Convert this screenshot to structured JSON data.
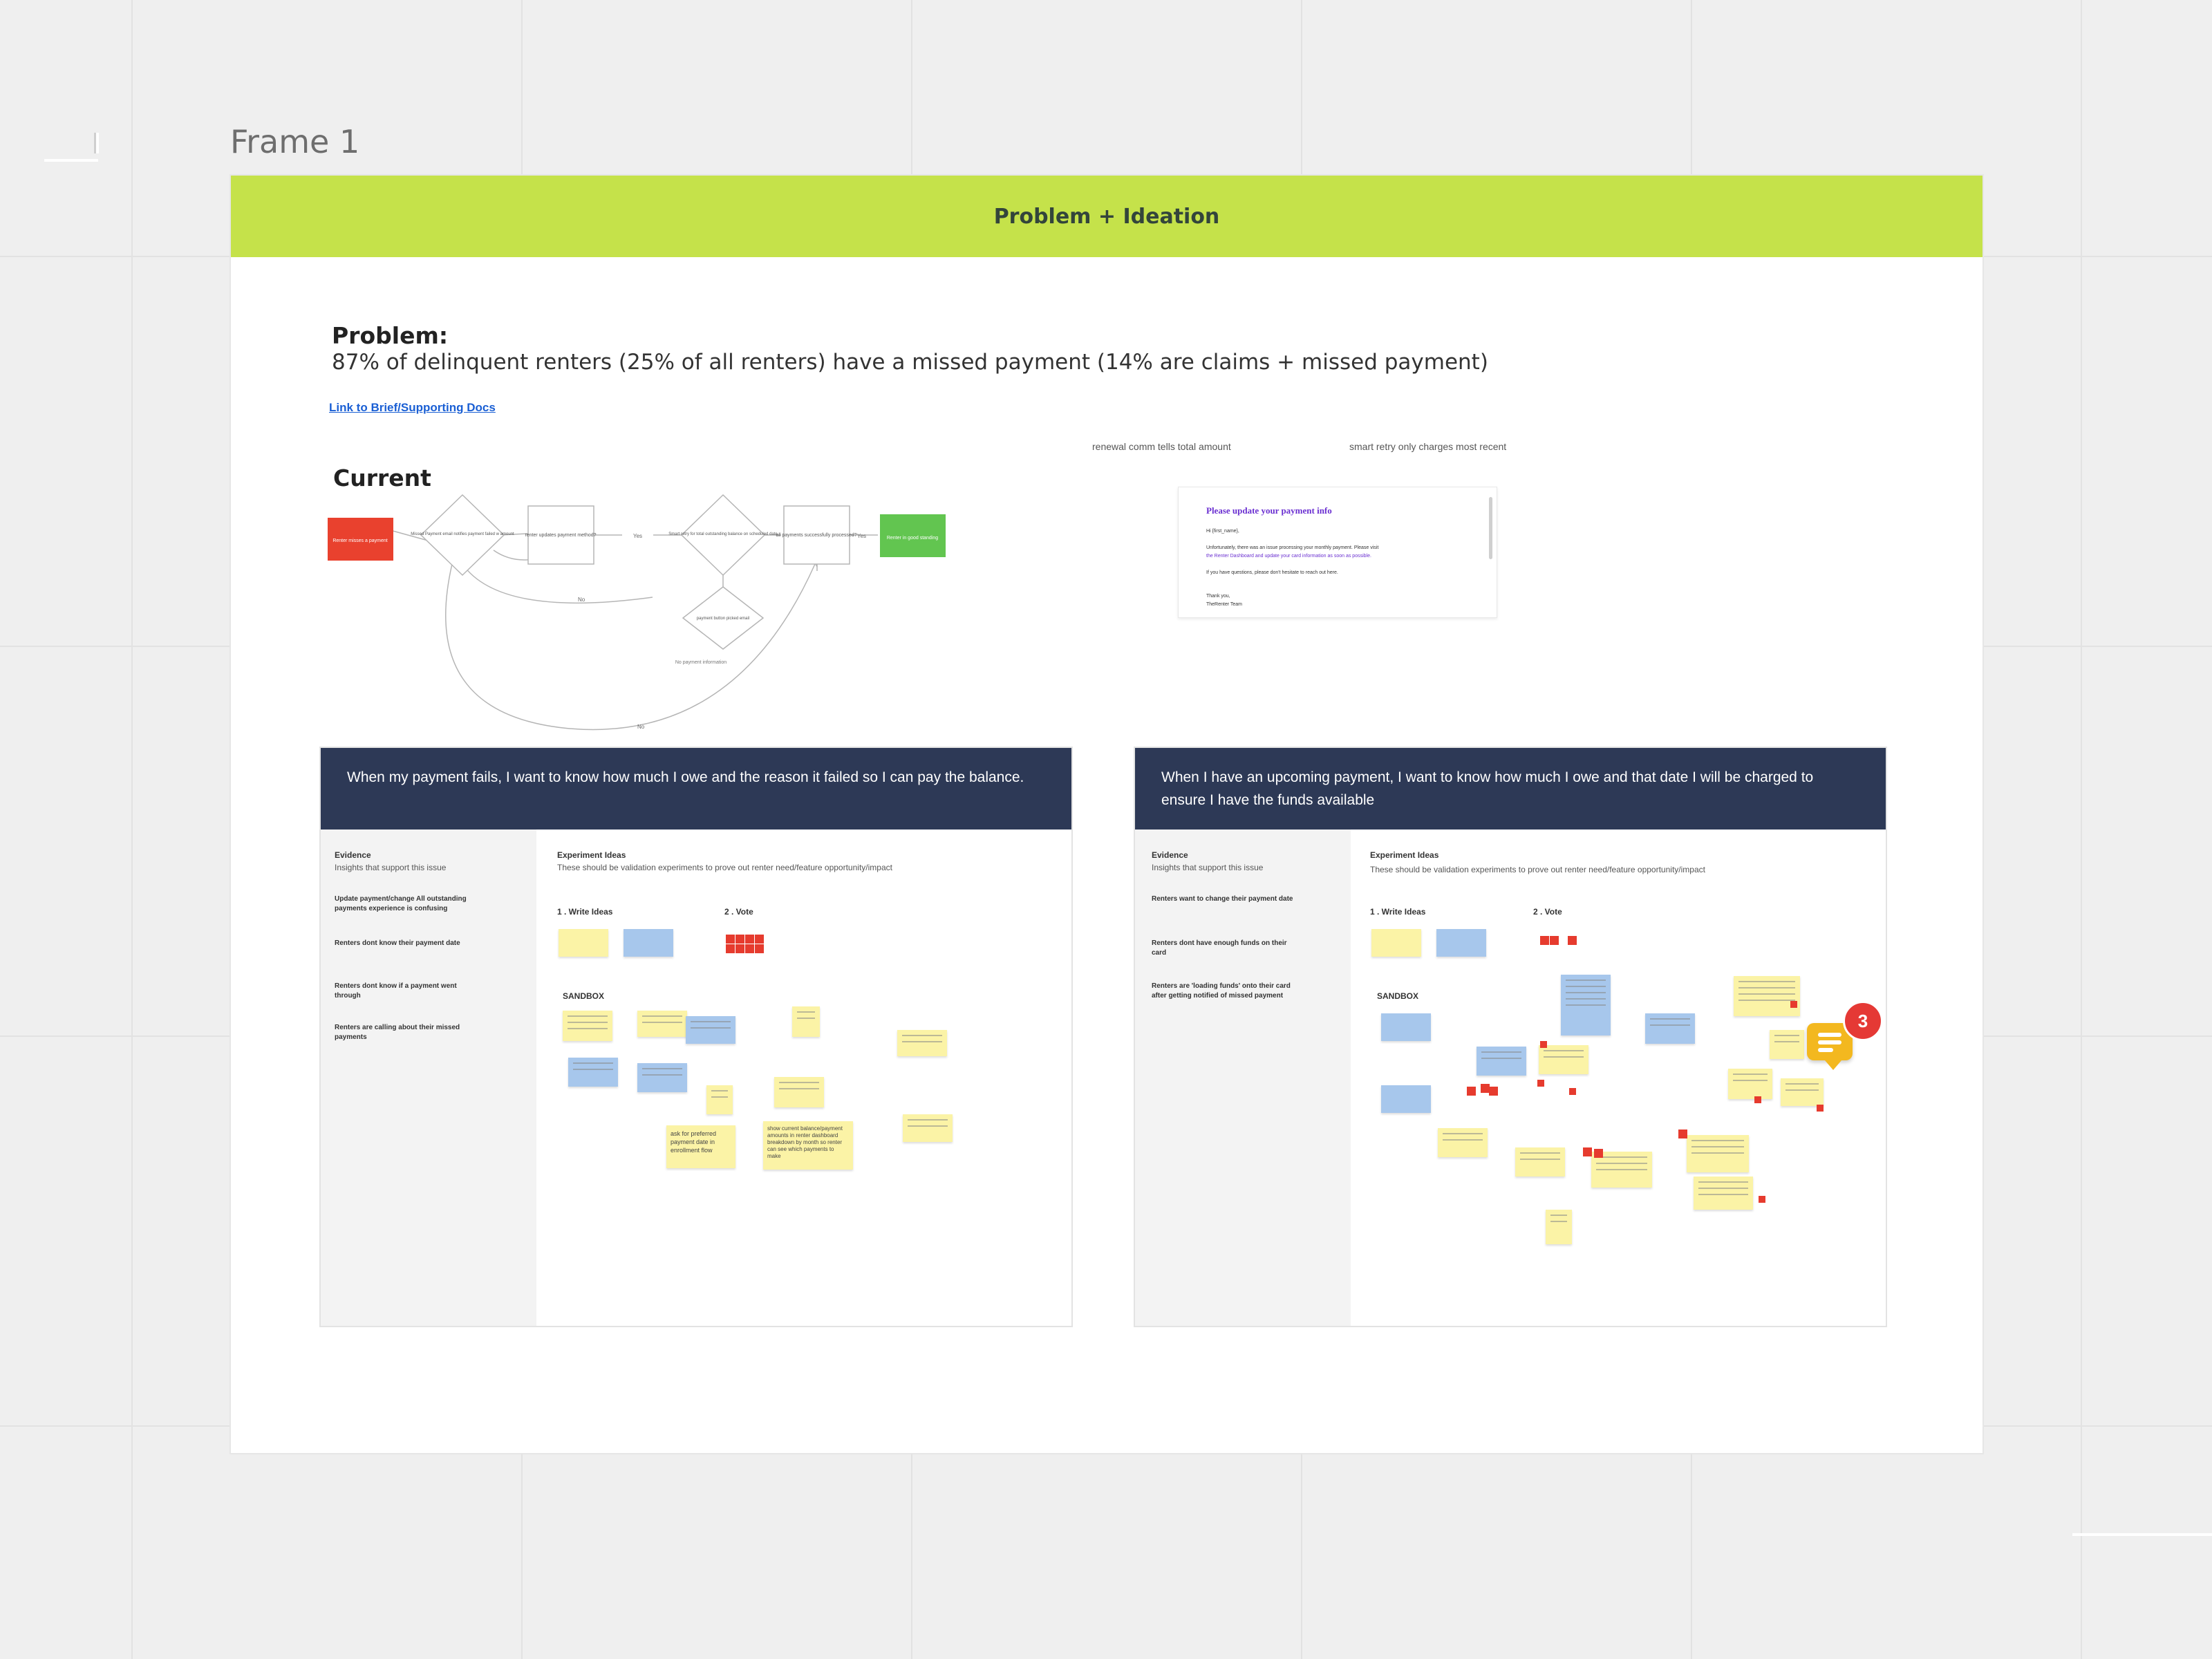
{
  "frame": {
    "label": "Frame 1"
  },
  "banner": {
    "title": "Problem + Ideation"
  },
  "problem": {
    "heading": "Problem:",
    "text": "87% of delinquent renters (25% of all renters) have a missed payment (14% are claims + missed payment)",
    "link": "Link to Brief/Supporting Docs"
  },
  "current": {
    "heading": "Current",
    "flow": {
      "start": "Renter misses a payment",
      "d1": "Missed Payment email notifies payment failed w amount",
      "p1": "renter updates payment method?",
      "yes1": "Yes",
      "d2": "Smart retry for total outstanding balance on scheduled date",
      "p2": "all payments successfully processed?",
      "yes2": "Yes",
      "end": "Renter in good standing",
      "d3": "payment button picked email",
      "no1": "No",
      "no2": "No",
      "loop": "No payment information"
    },
    "notes": [
      "renewal comm tells total amount",
      "smart retry only charges most recent"
    ],
    "email": {
      "subject": "Please update your payment info",
      "lines": [
        "Hi {first_name},",
        "Unfortunately, there was an issue processing your monthly payment. Please visit",
        "the Renter Dashboard and update your card information as soon as possible.",
        "If you have questions, please don't hesitate to reach out here.",
        "Thank you,",
        "TheRenter Team"
      ]
    }
  },
  "card_left": {
    "header": "When my payment fails, I want to know how much I owe and the reason it failed so I can pay the balance.",
    "evidence_title": "Evidence",
    "evidence_sub": "Insights that support this issue",
    "evidence": [
      "Update payment/change All outstanding payments experience is confusing",
      "Renters dont know their payment date",
      "Renters dont know if a payment went through",
      "Renters are calling about their missed payments"
    ],
    "exp_title": "Experiment Ideas",
    "exp_sub": "These should be validation experiments to prove out renter need/feature opportunity/impact",
    "step1": "1 . Write Ideas",
    "step2": "2 . Vote",
    "sandbox": "SANDBOX",
    "stickies": [
      "ask for preferred payment date in enrollment flow",
      "show current balance/payment amounts in renter dashboard breakdown by month so renter can see which payments to make"
    ]
  },
  "card_right": {
    "header": "When I have an upcoming payment, I want to know how much I owe and that date I will be charged to ensure I have the funds available",
    "evidence_title": "Evidence",
    "evidence_sub": "Insights that support this issue",
    "evidence": [
      "Renters want to change their payment date",
      "Renters dont have enough funds on their card",
      "Renters are 'loading funds' onto their card after getting notified of missed payment"
    ],
    "exp_title": "Experiment Ideas",
    "exp_sub": "These should be validation experiments to prove out renter need/feature opportunity/impact",
    "step1": "1 . Write Ideas",
    "step2": "2 . Vote",
    "sandbox": "SANDBOX"
  },
  "comments": {
    "count": "3"
  },
  "colors": {
    "banner": "#c5e24a",
    "card_header": "#2d3956",
    "sticky_yellow": "#fbf3a6",
    "sticky_blue": "#a7c7ec",
    "vote_dot": "#e63b2e",
    "flow_start": "#e9412e",
    "flow_end": "#62c550",
    "badge": "#e53935"
  },
  "icons": [
    "comment-icon"
  ]
}
